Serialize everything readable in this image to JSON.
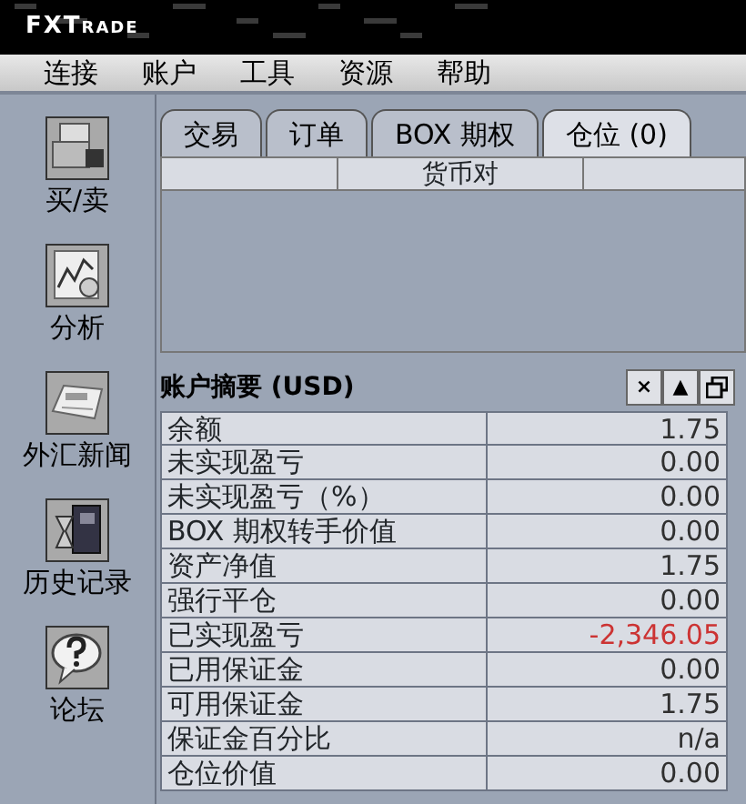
{
  "app": {
    "logo": "FXTrade"
  },
  "menu": [
    "连接",
    "账户",
    "工具",
    "资源",
    "帮助"
  ],
  "sidebar": {
    "items": [
      {
        "label": "买/卖",
        "kind": "trade"
      },
      {
        "label": "分析",
        "kind": "chart"
      },
      {
        "label": "外汇新闻",
        "kind": "news"
      },
      {
        "label": "历史记录",
        "kind": "history"
      },
      {
        "label": "论坛",
        "kind": "forum"
      }
    ]
  },
  "tabs": [
    {
      "label": "交易",
      "selected": false
    },
    {
      "label": "订单",
      "selected": false
    },
    {
      "label": "BOX 期权",
      "selected": false
    },
    {
      "label": "仓位 (0)",
      "selected": true
    }
  ],
  "positions_table": {
    "columns": [
      "货币对"
    ]
  },
  "summary": {
    "title": "账户摘要 (USD)",
    "controls": [
      "×",
      "▲"
    ],
    "rows": [
      {
        "label": "余额",
        "value": "1.75",
        "color": "#303030"
      },
      {
        "label": "未实现盈亏",
        "value": "0.00",
        "color": "#303030"
      },
      {
        "label": "未实现盈亏（%）",
        "value": "0.00",
        "color": "#303030"
      },
      {
        "label": "BOX 期权转手价值",
        "value": "0.00",
        "color": "#303030"
      },
      {
        "label": "资产净值",
        "value": "1.75",
        "color": "#303030"
      },
      {
        "label": "强行平仓",
        "value": "0.00",
        "color": "#303030"
      },
      {
        "label": "已实现盈亏",
        "value": "-2,346.05",
        "color": "#cc3333"
      },
      {
        "label": "已用保证金",
        "value": "0.00",
        "color": "#303030"
      },
      {
        "label": "可用保证金",
        "value": "1.75",
        "color": "#303030"
      },
      {
        "label": "保证金百分比",
        "value": "n/a",
        "color": "#303030"
      },
      {
        "label": "仓位价值",
        "value": "0.00",
        "color": "#303030"
      }
    ]
  }
}
